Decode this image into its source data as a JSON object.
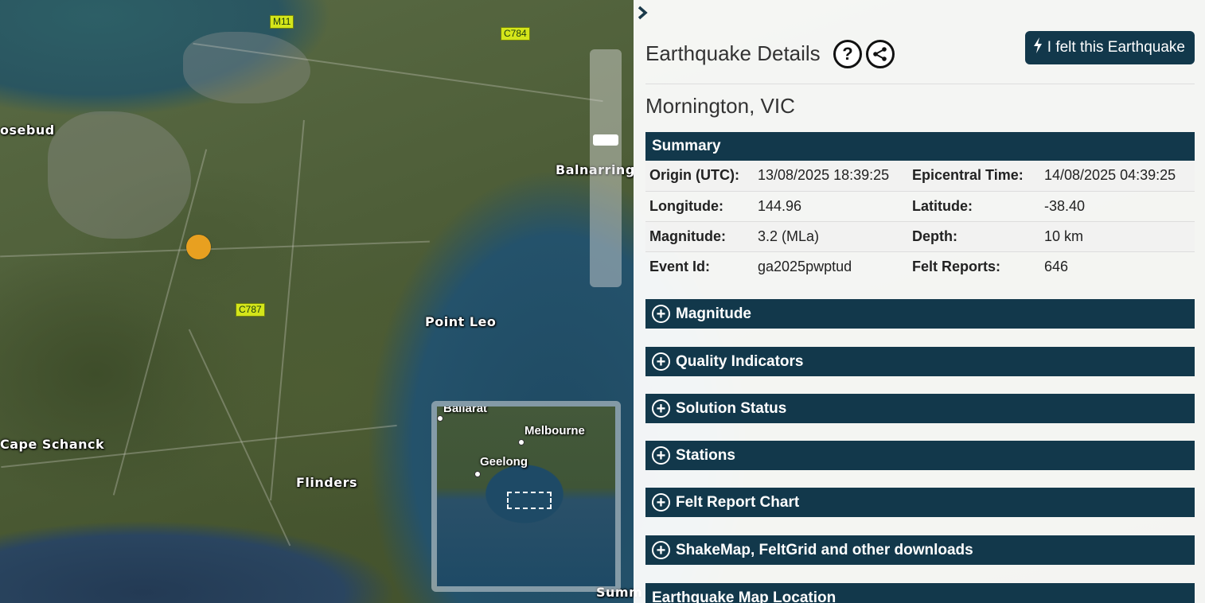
{
  "map": {
    "labels": {
      "rosebud": "osebud",
      "balnarring": "Balnarring",
      "point_leo": "Point Leo",
      "cape_schanck": "Cape Schanck",
      "flinders": "Flinders",
      "summerlands": "Summ"
    },
    "road_shields": {
      "m11": "M11",
      "c784": "C784",
      "c787": "C787"
    },
    "epicentre_color": "#e8a020",
    "overview": {
      "ballarat": "Ballarat",
      "melbourne": "Melbourne",
      "geelong": "Geelong"
    }
  },
  "panel": {
    "collapse_icon": "chevron-right-icon",
    "title": "Earthquake Details",
    "help_icon": "?",
    "share_icon": "share-icon",
    "felt_button": "I felt this Earthquake",
    "location": "Mornington, VIC",
    "summary": {
      "heading": "Summary",
      "rows": [
        {
          "l1": "Origin (UTC):",
          "v1": "13/08/2025 18:39:25",
          "l2": "Epicentral Time:",
          "v2": "14/08/2025 04:39:25"
        },
        {
          "l1": "Longitude:",
          "v1": "144.96",
          "l2": "Latitude:",
          "v2": "-38.40"
        },
        {
          "l1": "Magnitude:",
          "v1": "3.2 (MLa)",
          "l2": "Depth:",
          "v2": "10 km"
        },
        {
          "l1": "Event Id:",
          "v1": "ga2025pwptud",
          "l2": "Felt Reports:",
          "v2": "646"
        }
      ]
    },
    "sections": {
      "magnitude": "Magnitude",
      "quality": "Quality Indicators",
      "solution": "Solution Status",
      "stations": "Stations",
      "felt_chart": "Felt Report Chart",
      "shakemap": "ShakeMap, FeltGrid and other downloads",
      "map_location": "Earthquake Map Location"
    },
    "accent_color": "#12384b"
  }
}
